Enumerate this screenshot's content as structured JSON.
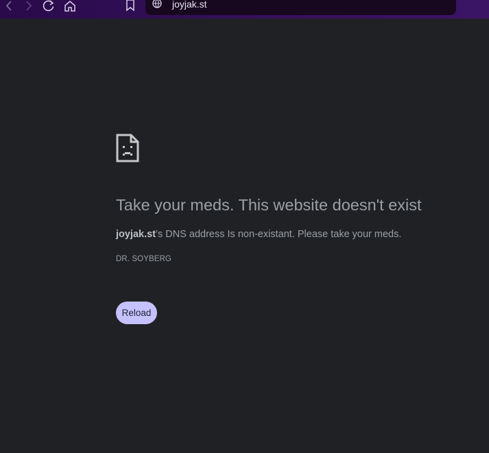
{
  "browser": {
    "url": "joyjak.st",
    "icons": {
      "back": "back-arrow-icon",
      "forward": "forward-arrow-icon",
      "reload": "reload-icon",
      "home": "home-icon",
      "bookmark": "bookmark-icon",
      "site_info": "globe-icon"
    },
    "toolbar_color": "#33105a"
  },
  "error_page": {
    "icon": "sad-page-icon",
    "title": "Take your meds. This website doesn't exist",
    "domain": "joyjak.st",
    "message_suffix": "’s DNS address Is non-existant. Please take your meds.",
    "error_code": "DR. SOYBERG",
    "reload_label": "Reload",
    "button_color": "#c6c2ff",
    "background_color": "#202124"
  }
}
